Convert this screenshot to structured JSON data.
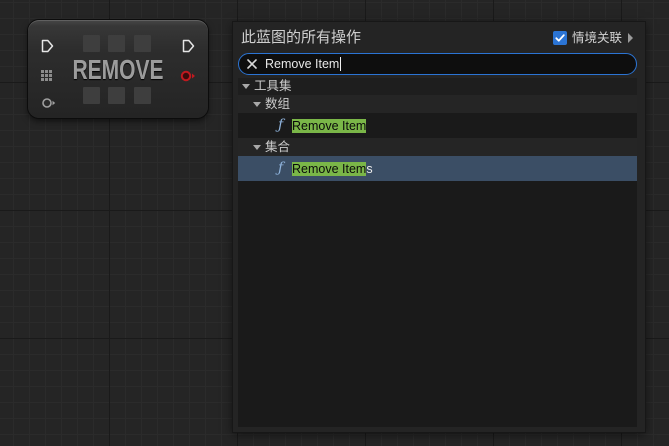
{
  "graph": {
    "node": {
      "title": "REMOVE"
    }
  },
  "action_menu": {
    "title": "此蓝图的所有操作",
    "context_sensitive": {
      "label": "情境关联",
      "checked": true
    },
    "search": {
      "value": "Remove Item"
    },
    "categories": [
      {
        "label": "工具集",
        "expanded": true,
        "subcategories": [
          {
            "label": "数组",
            "expanded": true,
            "actions": [
              {
                "match": "Remove Item",
                "selected": false
              }
            ]
          },
          {
            "label": "集合",
            "expanded": true,
            "actions": [
              {
                "match": "Remove Item",
                "rest": "s",
                "selected": true
              }
            ]
          }
        ]
      }
    ]
  },
  "icons": {
    "exec_pin": "exec-pin-icon",
    "array_pin": "array-pin-icon",
    "bool_pin": "bool-pin-icon",
    "wildcard_pin": "wildcard-pin-icon",
    "clear_search": "close-icon",
    "expand": "chevron-down-icon",
    "more_options": "chevron-right-icon",
    "check": "checkmark-icon",
    "function": "function-icon",
    "function_glyph": "ƒ"
  },
  "colors": {
    "accent": "#2b74d4",
    "highlight": "#7ab648",
    "selection": "#3b4e65",
    "pin_red": "#c0191f",
    "function_icon": "#8fb3dc"
  }
}
